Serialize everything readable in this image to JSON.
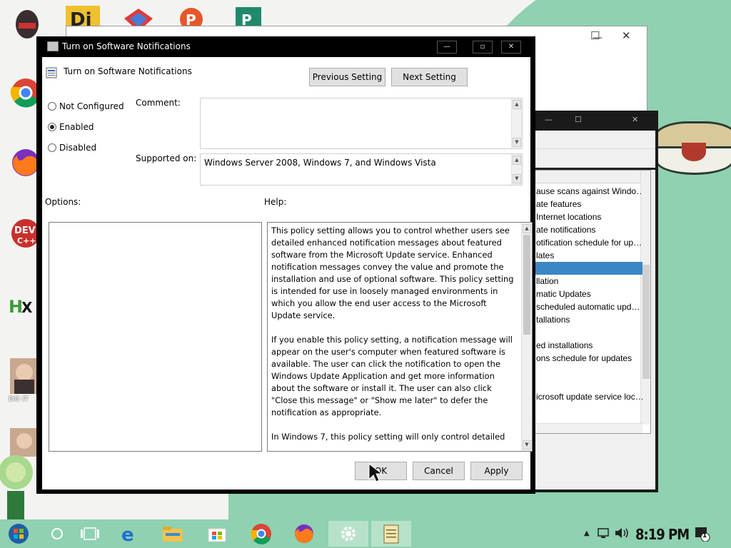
{
  "dialog": {
    "title": "Turn on Software Notifications",
    "header_title": "Turn on Software Notifications",
    "previous_label": "Previous Setting",
    "next_label": "Next Setting",
    "radio_not_configured": "Not Configured",
    "radio_enabled": "Enabled",
    "radio_disabled": "Disabled",
    "selected_option": "Enabled",
    "comment_label": "Comment:",
    "comment_value": "",
    "supported_label": "Supported on:",
    "supported_value": "Windows Server 2008, Windows 7, and Windows Vista",
    "options_label": "Options:",
    "help_label": "Help:",
    "help_paragraphs": [
      "This policy setting allows you to control whether users see detailed enhanced notification messages about featured software from the Microsoft Update service. Enhanced notification messages convey the value and promote the installation and use of optional software. This policy setting is intended for use in loosely managed environments in which you allow the end user access to the Microsoft Update service.",
      "If you enable this policy setting, a notification message will appear on the user's computer when featured software is available. The user can click the notification to open the Windows Update Application and get more information about the software or install it. The user can also click \"Close this message\" or \"Show me later\" to defer the notification as appropriate.",
      "In Windows 7, this policy setting will only control detailed"
    ],
    "ok_label": "OK",
    "cancel_label": "Cancel",
    "apply_label": "Apply"
  },
  "background_list": {
    "rows": [
      "ause scans against Windo…",
      "ate features",
      "Internet locations",
      "ate notifications",
      "otification schedule for up…",
      "lates",
      "",
      "llation",
      "matic Updates",
      "scheduled automatic upd…",
      "tallations",
      "",
      "ed installations",
      "ons schedule for updates",
      "",
      "",
      "icrosoft update service loc…"
    ],
    "selected_row": 6
  },
  "desktop": {
    "icon_labels": [
      "DO IT"
    ]
  },
  "taskbar": {
    "time": "8:19 PM",
    "notification_count": "1"
  },
  "colors": {
    "taskbar": "#8fd1b0",
    "selection": "#3b86c4",
    "dialog_border": "#000000"
  }
}
